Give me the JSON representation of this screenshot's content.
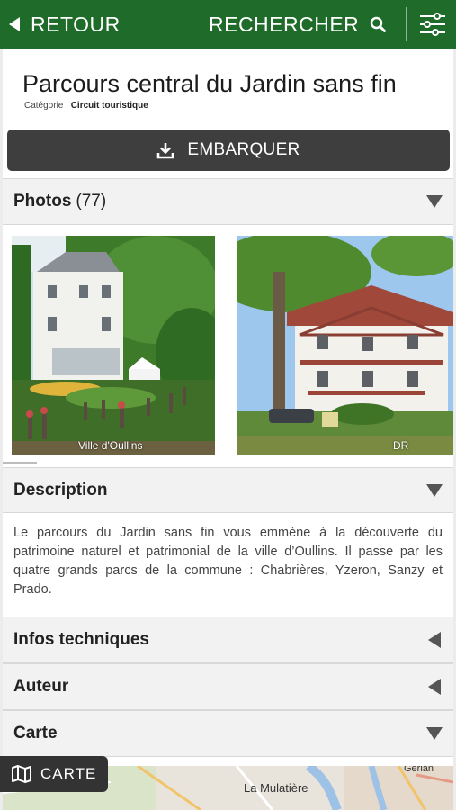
{
  "topbar": {
    "back_label": "RETOUR",
    "search_label": "RECHERCHER",
    "icons": [
      "back-arrow-icon",
      "search-icon",
      "filter-sliders-icon"
    ],
    "color": "#1f6b2a"
  },
  "page": {
    "title": "Parcours central du Jardin sans fin",
    "category_prefix": "Catégorie :",
    "category_value": "Circuit touristique"
  },
  "embark": {
    "label": "EMBARQUER",
    "icon": "download-icon"
  },
  "photos": {
    "label": "Photos",
    "count": "(77)",
    "items": [
      {
        "credit": "Ville d'Oullins"
      },
      {
        "credit": "DR"
      }
    ]
  },
  "description": {
    "label": "Description",
    "text": "Le parcours du Jardin sans fin vous emmène à la découverte du patrimoine naturel et patrimonial de la ville d’Oullins. Il passe par les quatre grands parcs de la commune : Chabrières, Yzeron, Sanzy et Prado."
  },
  "sections": {
    "tech": "Infos techniques",
    "author": "Auteur",
    "map": "Carte"
  },
  "map": {
    "place_label": "La Mulatière",
    "place_label_2": "Gerlan",
    "button_label": "CARTE",
    "button_icon": "map-icon"
  }
}
